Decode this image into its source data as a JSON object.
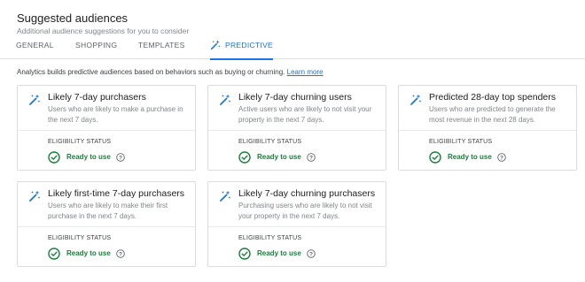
{
  "header": {
    "title": "Suggested audiences",
    "subtitle": "Additional audience suggestions for you to consider"
  },
  "tabs": [
    {
      "label": "GENERAL",
      "active": false
    },
    {
      "label": "SHOPPING",
      "active": false
    },
    {
      "label": "TEMPLATES",
      "active": false
    },
    {
      "label": "PREDICTIVE",
      "active": true,
      "icon": "magic-wand-icon"
    }
  ],
  "intro": {
    "text": "Analytics builds predictive audiences based on behaviors such as buying or churning.",
    "link": "Learn more"
  },
  "colors": {
    "accent": "#1a73e8",
    "ready": "#188038",
    "border": "#dadce0"
  },
  "cards": [
    {
      "title": "Likely 7-day purchasers",
      "description": "Users who are likely to make a purchase in the next 7 days.",
      "eligibility_label": "ELIGIBILITY STATUS",
      "status": "Ready to use",
      "icon": "magic-wand-icon"
    },
    {
      "title": "Likely 7-day churning users",
      "description": "Active users who are likely to not visit your property in the next 7 days.",
      "eligibility_label": "ELIGIBILITY STATUS",
      "status": "Ready to use",
      "icon": "magic-wand-icon"
    },
    {
      "title": "Predicted 28-day top spenders",
      "description": "Users who are predicted to generate the most revenue in the next 28 days.",
      "eligibility_label": "ELIGIBILITY STATUS",
      "status": "Ready to use",
      "icon": "magic-wand-icon"
    },
    {
      "title": "Likely first-time 7-day purchasers",
      "description": "Users who are likely to make their first purchase in the next 7 days.",
      "eligibility_label": "ELIGIBILITY STATUS",
      "status": "Ready to use",
      "icon": "magic-wand-icon"
    },
    {
      "title": "Likely 7-day churning purchasers",
      "description": "Purchasing users who are likely to not visit your property in the next 7 days.",
      "eligibility_label": "ELIGIBILITY STATUS",
      "status": "Ready to use",
      "icon": "magic-wand-icon"
    }
  ]
}
